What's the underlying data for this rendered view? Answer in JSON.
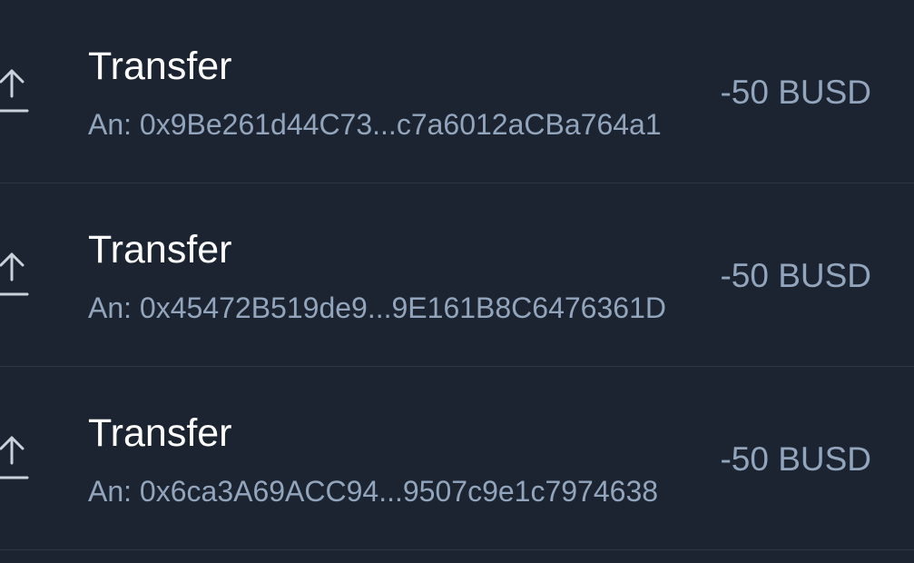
{
  "transactions": [
    {
      "icon": "upload-arrow-icon",
      "title": "Transfer",
      "address": "An: 0x9Be261d44C73...c7a6012aCBa764a1",
      "amount": "-50 BUSD"
    },
    {
      "icon": "upload-arrow-icon",
      "title": "Transfer",
      "address": "An: 0x45472B519de9...9E161B8C6476361D",
      "amount": "-50 BUSD"
    },
    {
      "icon": "upload-arrow-icon",
      "title": "Transfer",
      "address": "An: 0x6ca3A69ACC94...9507c9e1c7974638",
      "amount": "-50 BUSD"
    }
  ],
  "colors": {
    "background": "#1b2430",
    "divider": "#2c3745",
    "title": "#ffffff",
    "secondary": "#93a5bd",
    "icon": "#c9d1db"
  }
}
